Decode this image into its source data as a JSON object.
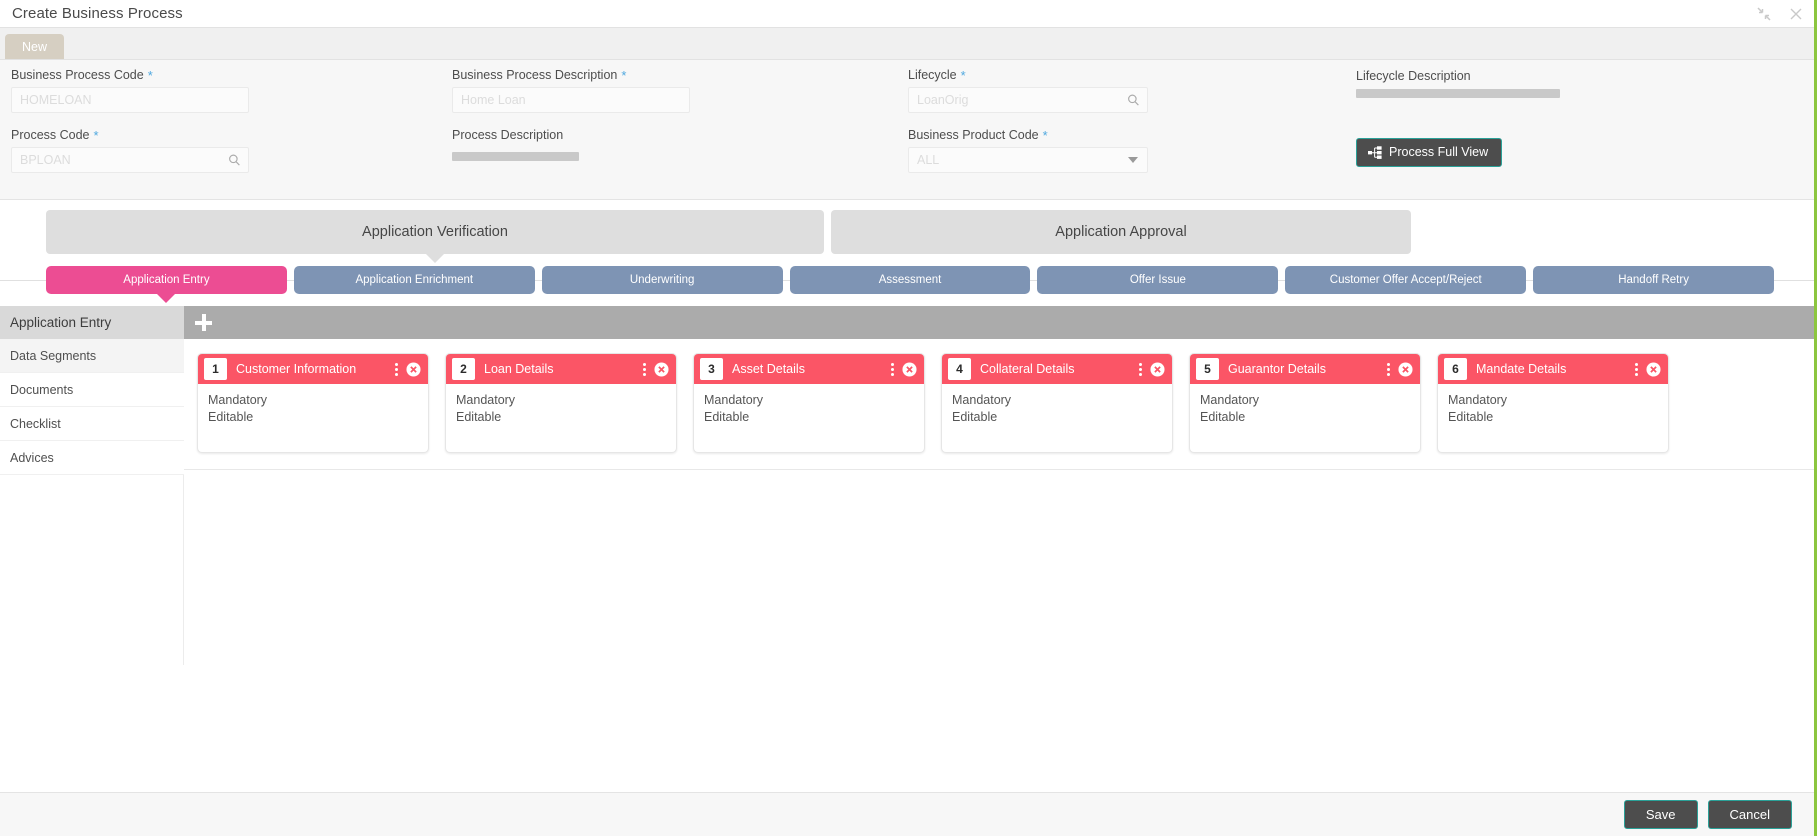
{
  "window": {
    "title": "Create Business Process",
    "minimize_icon": "collapse-arrows-icon",
    "close_icon": "close-icon"
  },
  "tabstrip": {
    "new_tab_label": "New"
  },
  "form": {
    "business_process_code": {
      "label": "Business Process Code",
      "required": true,
      "placeholder": "HOMELOAN",
      "value": ""
    },
    "process_code": {
      "label": "Process Code",
      "required": true,
      "placeholder": "BPLOAN",
      "value": ""
    },
    "business_process_description": {
      "label": "Business Process Description",
      "required": true,
      "placeholder": "Home Loan",
      "value": ""
    },
    "process_description": {
      "label": "Process Description",
      "required": false,
      "value": ""
    },
    "lifecycle": {
      "label": "Lifecycle",
      "required": true,
      "placeholder": "LoanOrig",
      "value": ""
    },
    "business_product_code": {
      "label": "Business Product Code",
      "required": true,
      "placeholder": "ALL",
      "value": "",
      "options": [
        "ALL"
      ]
    },
    "lifecycle_description": {
      "label": "Lifecycle Description",
      "required": false,
      "value": ""
    },
    "process_full_view_button": "Process Full View"
  },
  "stages": [
    {
      "label": "Application Verification"
    },
    {
      "label": "Application Approval"
    }
  ],
  "steps": [
    {
      "label": "Application Entry",
      "active": true
    },
    {
      "label": "Application Enrichment",
      "active": false
    },
    {
      "label": "Underwriting",
      "active": false
    },
    {
      "label": "Assessment",
      "active": false
    },
    {
      "label": "Offer Issue",
      "active": false
    },
    {
      "label": "Customer Offer Accept/Reject",
      "active": false
    },
    {
      "label": "Handoff Retry",
      "active": false
    }
  ],
  "sidebar": {
    "header": "Application Entry",
    "items": [
      {
        "label": "Data Segments",
        "selected": true
      },
      {
        "label": "Documents",
        "selected": false
      },
      {
        "label": "Checklist",
        "selected": false
      },
      {
        "label": "Advices",
        "selected": false
      }
    ]
  },
  "content": {
    "add_button_icon": "plus-icon",
    "cards": [
      {
        "number": "1",
        "title": "Customer Information",
        "line1": "Mandatory",
        "line2": "Editable"
      },
      {
        "number": "2",
        "title": "Loan Details",
        "line1": "Mandatory",
        "line2": "Editable"
      },
      {
        "number": "3",
        "title": "Asset Details",
        "line1": "Mandatory",
        "line2": "Editable"
      },
      {
        "number": "4",
        "title": "Collateral Details",
        "line1": "Mandatory",
        "line2": "Editable"
      },
      {
        "number": "5",
        "title": "Guarantor Details",
        "line1": "Mandatory",
        "line2": "Editable"
      },
      {
        "number": "6",
        "title": "Mandate Details",
        "line1": "Mandatory",
        "line2": "Editable"
      }
    ]
  },
  "footer": {
    "save_label": "Save",
    "cancel_label": "Cancel"
  },
  "colors": {
    "accent_pink": "#ec4d93",
    "card_red": "#fb5566",
    "step_blue": "#7e94b4",
    "stage_gray": "#dedede",
    "toolbar_gray": "#ababab",
    "button_dark": "#4d4d4d",
    "button_border_teal": "#2aa198",
    "required_star": "#4fa8df",
    "edge_green": "#8cc63f"
  }
}
